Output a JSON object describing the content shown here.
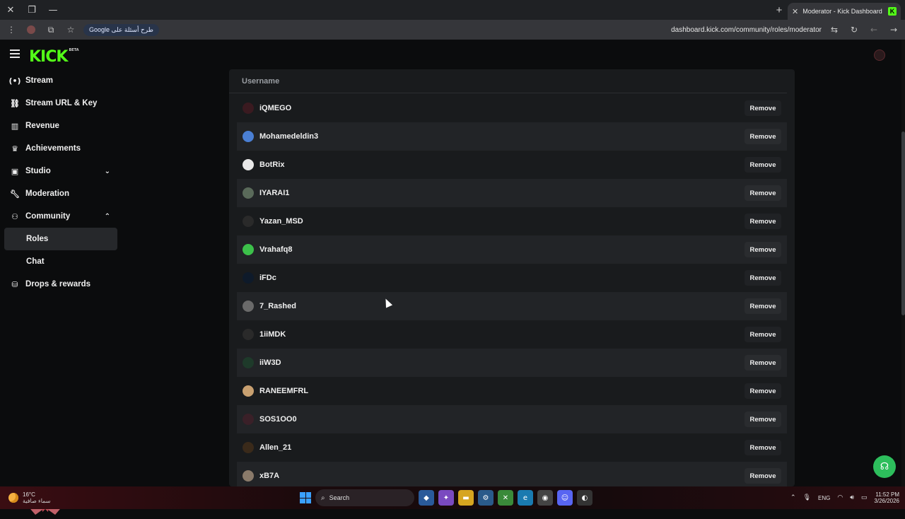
{
  "browser": {
    "tab_title": "Moderator - Kick Dashboard",
    "tab_favicon": "K",
    "google_chip": "Google طرح أسئلة على",
    "url": "dashboard.kick.com/community/roles/moderator"
  },
  "app": {
    "logo": "KICK",
    "logo_badge": "BETA"
  },
  "sidebar": {
    "items": [
      {
        "label": "Stream",
        "icon": "broadcast-icon"
      },
      {
        "label": "Stream URL & Key",
        "icon": "link-icon"
      },
      {
        "label": "Revenue",
        "icon": "chart-icon"
      },
      {
        "label": "Achievements",
        "icon": "trophy-icon"
      },
      {
        "label": "Studio",
        "icon": "studio-icon"
      },
      {
        "label": "Moderation",
        "icon": "wrench-icon"
      },
      {
        "label": "Community",
        "icon": "users-icon"
      },
      {
        "label": "Roles"
      },
      {
        "label": "Chat"
      },
      {
        "label": "Drops & rewards",
        "icon": "gift-icon"
      }
    ]
  },
  "table": {
    "header": "Username",
    "remove_label": "Remove",
    "rows": [
      {
        "username": "iQMEGO",
        "avatar_color": "#3a1a20"
      },
      {
        "username": "Mohamedeldin3",
        "avatar_color": "#4a7fd4"
      },
      {
        "username": "BotRix",
        "avatar_color": "#e8e8e8"
      },
      {
        "username": "IYARAI1",
        "avatar_color": "#5a6a5a"
      },
      {
        "username": "Yazan_MSD",
        "avatar_color": "#2a2a2a"
      },
      {
        "username": "Vrahafq8",
        "avatar_color": "#3cc04a"
      },
      {
        "username": "iFDc",
        "avatar_color": "#0e1a2a"
      },
      {
        "username": "7_Rashed",
        "avatar_color": "#6a6a6a"
      },
      {
        "username": "1iiMDK",
        "avatar_color": "#2a2a2a"
      },
      {
        "username": "iiW3D",
        "avatar_color": "#1e3a2a"
      },
      {
        "username": "RANEEMFRL",
        "avatar_color": "#c8a070"
      },
      {
        "username": "SOS1OO0",
        "avatar_color": "#3a2028"
      },
      {
        "username": "Allen_21",
        "avatar_color": "#3a2a1a"
      },
      {
        "username": "xB7A",
        "avatar_color": "#8a7a6a"
      }
    ]
  },
  "taskbar": {
    "temperature": "16°C",
    "condition": "سماء صافية",
    "search_placeholder": "Search",
    "language": "ENG",
    "time": "11:52 PM",
    "date": "3/26/2026"
  }
}
